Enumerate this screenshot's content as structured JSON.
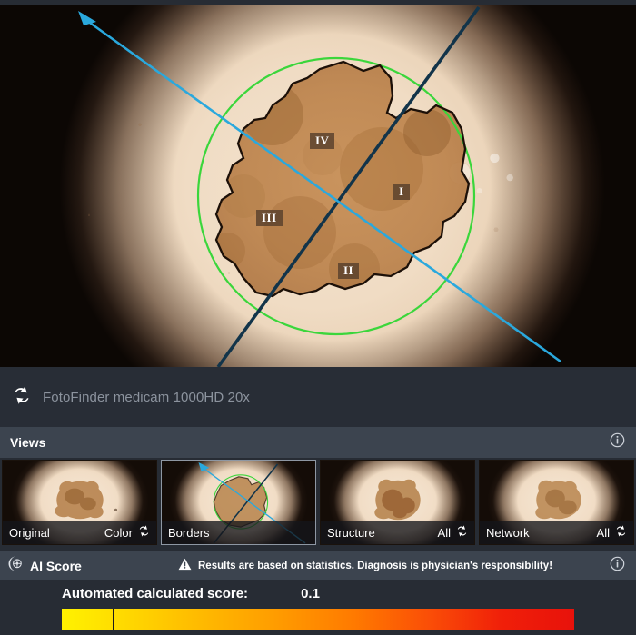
{
  "viewer": {
    "overlay": {
      "quadrant_labels": [
        "I",
        "II",
        "III",
        "IV"
      ],
      "border_color": "#1c1008",
      "circle_color": "#3bd63b",
      "axis_primary_color": "#12344a",
      "axis_secondary_color": "#2aa8dd"
    }
  },
  "camera": {
    "swap_icon": "swap-arrows-icon",
    "label": "FotoFinder medicam 1000HD 20x"
  },
  "views": {
    "title": "Views",
    "info_icon": "info-circle-icon",
    "thumbnails": [
      {
        "label": "Original",
        "mode": "Color",
        "has_mode_toggle": true,
        "selected": false
      },
      {
        "label": "Borders",
        "mode": "",
        "has_mode_toggle": false,
        "selected": true
      },
      {
        "label": "Structure",
        "mode": "All",
        "has_mode_toggle": true,
        "selected": false
      },
      {
        "label": "Network",
        "mode": "All",
        "has_mode_toggle": true,
        "selected": false
      }
    ]
  },
  "ai_score": {
    "icon": "brain-circuit-icon",
    "title": "AI Score",
    "warning_icon": "warning-triangle-icon",
    "warning_text": "Results are based on statistics. Diagnosis is physician's responsibility!",
    "info_icon": "info-circle-icon",
    "score_label": "Automated calculated score:",
    "score_value": "0.1",
    "scale_min": 0,
    "scale_max": 1,
    "marker_percent": 10,
    "gradient_start_color": "#fff200",
    "gradient_end_color": "#e8120b"
  }
}
